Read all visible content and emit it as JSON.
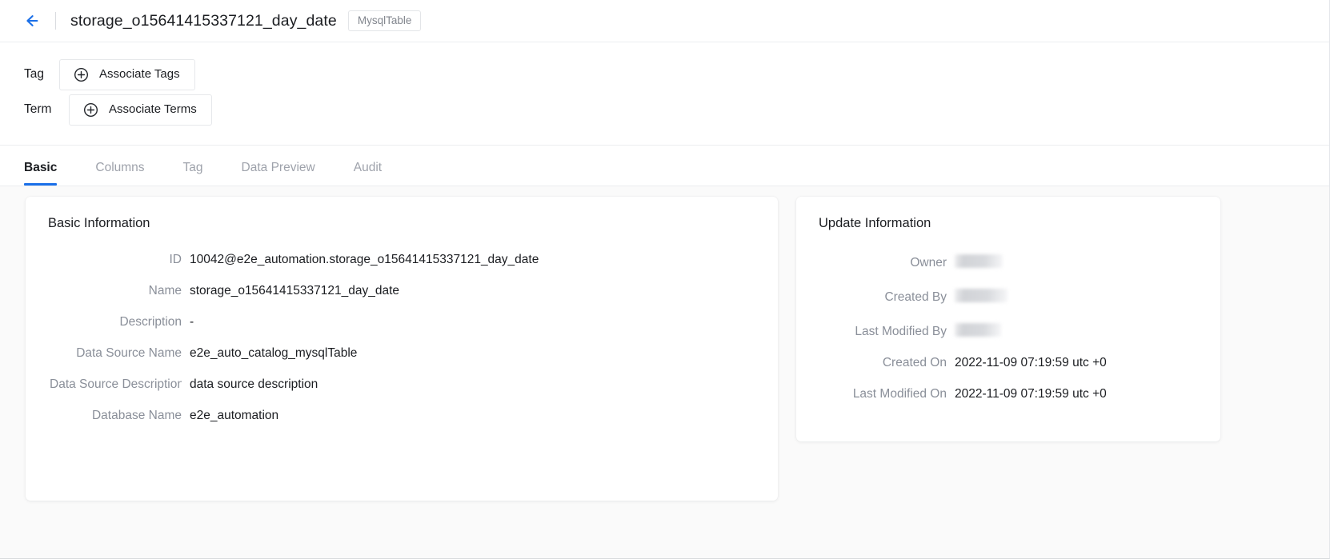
{
  "header": {
    "back_icon": "arrow-left-icon",
    "title": "storage_o15641415337121_day_date",
    "badge": "MysqlTable"
  },
  "association": {
    "tag_label": "Tag",
    "tag_button": "Associate Tags",
    "term_label": "Term",
    "term_button": "Associate Terms",
    "add_icon": "plus-circle-icon"
  },
  "tabs": [
    {
      "label": "Basic",
      "active": true
    },
    {
      "label": "Columns",
      "active": false
    },
    {
      "label": "Tag",
      "active": false
    },
    {
      "label": "Data Preview",
      "active": false
    },
    {
      "label": "Audit",
      "active": false
    }
  ],
  "basic_information": {
    "title": "Basic Information",
    "fields": [
      {
        "label": "ID",
        "value": "10042@e2e_automation.storage_o15641415337121_day_date"
      },
      {
        "label": "Name",
        "value": "storage_o15641415337121_day_date"
      },
      {
        "label": "Description",
        "value": "-"
      },
      {
        "label": "Data Source Name",
        "value": "e2e_auto_catalog_mysqlTable"
      },
      {
        "label": "Data Source Description",
        "value": "data source description"
      },
      {
        "label": "Database Name",
        "value": "e2e_automation"
      }
    ]
  },
  "update_information": {
    "title": "Update Information",
    "fields": [
      {
        "label": "Owner",
        "value": "",
        "redacted": true
      },
      {
        "label": "Created By",
        "value": "",
        "redacted": true
      },
      {
        "label": "Last Modified By",
        "value": "",
        "redacted": true
      },
      {
        "label": "Created On",
        "value": "2022-11-09 07:19:59 utc +0",
        "redacted": false
      },
      {
        "label": "Last Modified On",
        "value": "2022-11-09 07:19:59 utc +0",
        "redacted": false
      }
    ]
  },
  "colors": {
    "accent": "#1a6fe8",
    "text": "#1b1d21",
    "muted": "#8a8f99",
    "page_bg": "#fafafa",
    "card_bg": "#ffffff"
  }
}
